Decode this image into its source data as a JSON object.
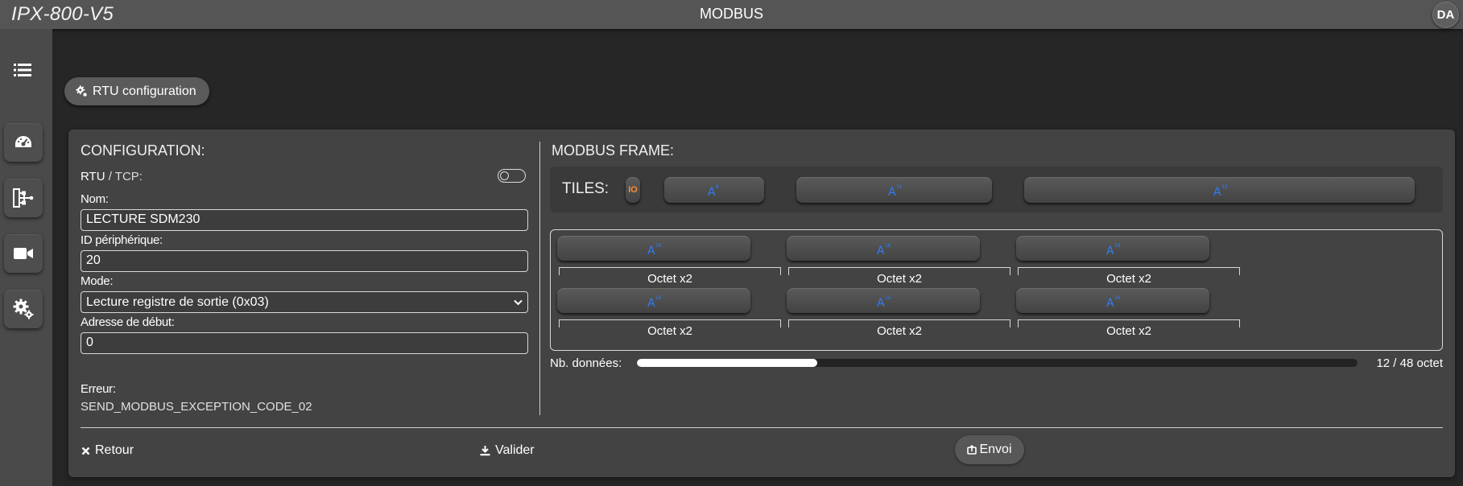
{
  "header": {
    "brand": "IPX-800-V5",
    "title": "MODBUS",
    "avatar": "DA"
  },
  "sidebar": {
    "items": [
      {
        "icon": "list-icon"
      },
      {
        "icon": "dashboard-icon"
      },
      {
        "icon": "network-icon"
      },
      {
        "icon": "camera-icon"
      },
      {
        "icon": "gears-icon"
      }
    ]
  },
  "rtu_button": {
    "label": "RTU configuration",
    "icon": "gears-icon"
  },
  "config": {
    "title": "CONFIGURATION:",
    "rtu_label": "RTU",
    "tcp_label": " / TCP:",
    "name_label": "Nom:",
    "name_value": "LECTURE SDM230",
    "id_label": "ID périphérique:",
    "id_value": "20",
    "mode_label": "Mode:",
    "mode_value": "Lecture registre de sortie (0x03)",
    "start_label": "Adresse de début:",
    "start_value": "0",
    "error_label": "Erreur:",
    "error_value": "SEND_MODBUS_EXCEPTION_CODE_02"
  },
  "frame": {
    "title": "MODBUS FRAME:",
    "tiles_label": "TILES:",
    "io_label": "IO",
    "registers": [
      {
        "label": "Octet x2"
      },
      {
        "label": "Octet x2"
      },
      {
        "label": "Octet x2"
      },
      {
        "label": "Octet x2"
      },
      {
        "label": "Octet x2"
      },
      {
        "label": "Octet x2"
      }
    ],
    "nb_label": "Nb. données:",
    "nb_count": "12 / 48 octet",
    "progress": 0.25
  },
  "footer": {
    "back_label": "Retour",
    "validate_label": "Valider",
    "send_label": "Envoi"
  },
  "colors": {
    "accent_blue": "#2f7df6",
    "io_orange": "#ff8b2c"
  }
}
